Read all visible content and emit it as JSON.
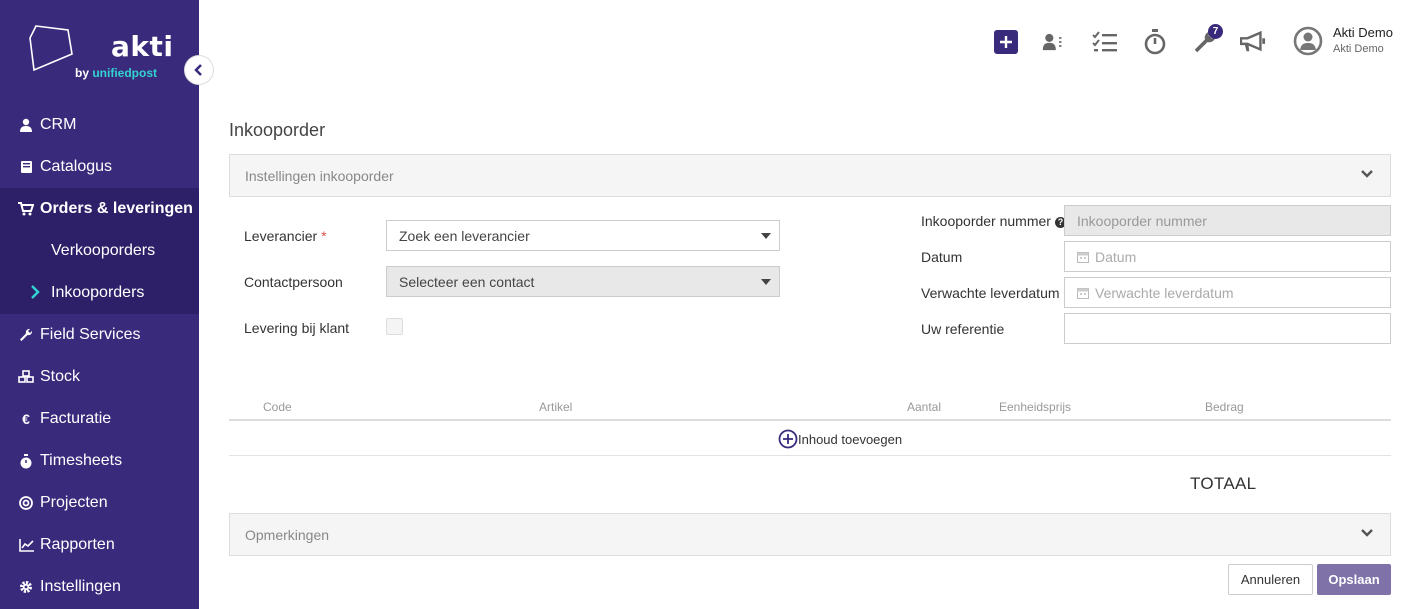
{
  "sidebar": {
    "logo_text": "akti",
    "logo_sub_prefix": "by ",
    "logo_sub_brand": "unifiedpost",
    "items": [
      {
        "label": "CRM",
        "icon": "user-icon"
      },
      {
        "label": "Catalogus",
        "icon": "book-icon"
      },
      {
        "label": "Orders & leveringen",
        "icon": "cart-icon",
        "active": true
      },
      {
        "label": "Verkooporders",
        "sub": true
      },
      {
        "label": "Inkooporders",
        "sub": true,
        "active": true
      },
      {
        "label": "Field Services",
        "icon": "wrench-icon"
      },
      {
        "label": "Stock",
        "icon": "cubes-icon"
      },
      {
        "label": "Facturatie",
        "icon": "euro-icon"
      },
      {
        "label": "Timesheets",
        "icon": "stopwatch-icon"
      },
      {
        "label": "Projecten",
        "icon": "target-icon"
      },
      {
        "label": "Rapporten",
        "icon": "chart-icon"
      },
      {
        "label": "Instellingen",
        "icon": "gear-icon"
      }
    ]
  },
  "topbar": {
    "notification_count": "7",
    "user_name": "Akti Demo",
    "user_company": "Akti Demo"
  },
  "page": {
    "title": "Inkooporder",
    "settings_panel": "Instellingen inkooporder",
    "remarks_panel": "Opmerkingen"
  },
  "form": {
    "supplier_label": "Leverancier",
    "supplier_required": "*",
    "supplier_value": "Zoek een leverancier",
    "contact_label": "Contactpersoon",
    "contact_value": "Selecteer een contact",
    "delivery_label": "Levering bij klant",
    "order_number_label": "Inkooporder nummer",
    "order_number_placeholder": "Inkooporder nummer",
    "date_label": "Datum",
    "date_placeholder": "Datum",
    "expected_label": "Verwachte leverdatum",
    "expected_placeholder": "Verwachte leverdatum",
    "reference_label": "Uw referentie",
    "reference_value": ""
  },
  "table": {
    "columns": [
      "Code",
      "Artikel",
      "Aantal",
      "Eenheidsprijs",
      "Bedrag"
    ],
    "add_label": "Inhoud toevoegen",
    "total_label": "TOTAAL"
  },
  "actions": {
    "cancel": "Annuleren",
    "save": "Opslaan"
  },
  "colors": {
    "sidebar": "#3a2a7c",
    "accent": "#33d2d0",
    "save_button": "#7e72a8"
  }
}
